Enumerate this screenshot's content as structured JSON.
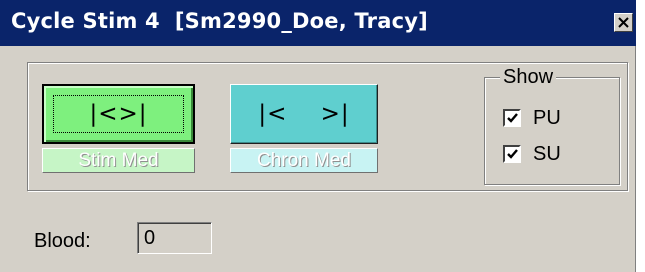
{
  "window": {
    "title": "Cycle Stim 4  [Sm2990_Doe, Tracy]",
    "close_icon": "close-icon"
  },
  "buttons": {
    "stim_main_label": "|<>|",
    "stim_sub_label": "Stim Med",
    "chron_main_label": "|<    >|",
    "chron_sub_label": "Chron Med"
  },
  "show": {
    "legend": "Show",
    "items": [
      {
        "label": "PU",
        "checked": true
      },
      {
        "label": "SU",
        "checked": true
      }
    ]
  },
  "blood": {
    "label": "Blood:",
    "value": "0"
  },
  "colors": {
    "titlebar": "#0a246a",
    "stim_button": "#7ef07e",
    "chron_button": "#5fcfcf",
    "window_bg": "#d4d0c8"
  }
}
